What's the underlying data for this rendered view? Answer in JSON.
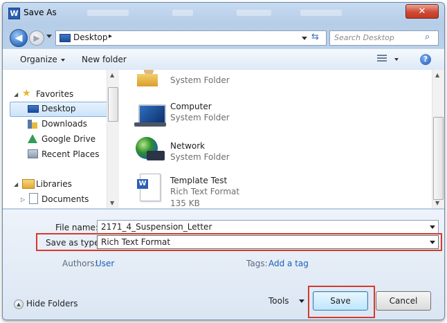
{
  "window": {
    "title": "Save As",
    "app_icon_letter": "W",
    "close_glyph": "✕"
  },
  "address": {
    "location": "Desktop",
    "separator": "▸",
    "search_placeholder": "Search Desktop"
  },
  "toolbar": {
    "organize": "Organize",
    "new_folder": "New folder",
    "help": "?"
  },
  "nav": {
    "favorites": "Favorites",
    "items": [
      "Desktop",
      "Downloads",
      "Google Drive",
      "Recent Places"
    ],
    "libraries": "Libraries",
    "library_items": [
      "Documents"
    ]
  },
  "files": [
    {
      "name": "",
      "desc": "System Folder",
      "icon": "user-folder-icon"
    },
    {
      "name": "Computer",
      "desc": "System Folder",
      "icon": "computer-icon"
    },
    {
      "name": "Network",
      "desc": "System Folder",
      "icon": "network-globe-icon"
    },
    {
      "name": "Template Test",
      "desc": "Rich Text Format",
      "size": "135 KB",
      "icon": "word-document-icon"
    }
  ],
  "form": {
    "filename_label": "File name:",
    "filename_value": "2171_4_Suspension_Letter",
    "type_label": "Save as type:",
    "type_value": "Rich Text Format",
    "authors_label": "Authors:",
    "authors_value": "User",
    "tags_label": "Tags:",
    "tags_value": "Add a tag"
  },
  "footer": {
    "hide_folders": "Hide Folders",
    "tools": "Tools",
    "save": "Save",
    "cancel": "Cancel"
  },
  "colors": {
    "highlight": "#d6392b",
    "link": "#1a5fb4"
  }
}
